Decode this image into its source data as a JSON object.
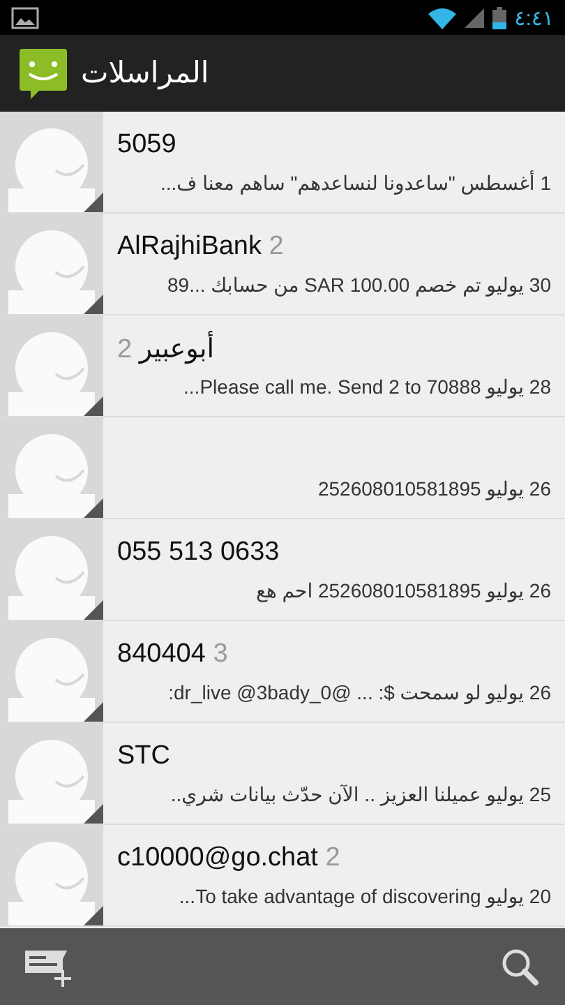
{
  "status_bar": {
    "time": "٤:٤١"
  },
  "action_bar": {
    "title": "المراسلات"
  },
  "conversations": [
    {
      "name": "5059",
      "preview": "1 أغسطس \"ساعدونا لنساعدهم\" ساهم معنا ف..."
    },
    {
      "name": "AlRajhiBank",
      "count": "2",
      "preview": "30 يوليو تم خصم SAR 100.00 من حسابك ...89"
    },
    {
      "name": "أبوعبير",
      "count": "2",
      "preview": "28 يوليو   Please call me.  Send 2 to 70888..."
    },
    {
      "preview": "26 يوليو 252608010581895"
    },
    {
      "name": "055 513 0633",
      "preview": "26 يوليو 252608010581895 احم هع"
    },
    {
      "name": "840404",
      "count": "3",
      "preview": "26 يوليو  لو سمحت $: ... @dr_live @3bady_0:"
    },
    {
      "name": "STC",
      "preview": "25 يوليو عميلنا العزيز .. الآن حدّث بيانات شري.."
    },
    {
      "name": "c10000@go.chat",
      "count": "2",
      "preview": "20 يوليو   To take advantage of discovering..."
    }
  ]
}
